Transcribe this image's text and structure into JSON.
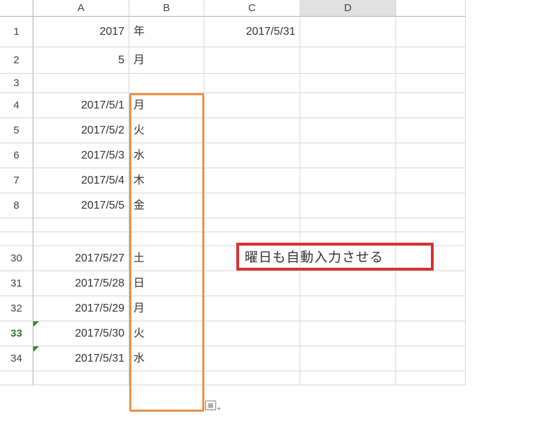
{
  "columns": [
    "",
    "A",
    "B",
    "C",
    "D",
    ""
  ],
  "active_column": "D",
  "active_row": 33,
  "rows_top": [
    {
      "num": 1,
      "a": "2017",
      "b": "年",
      "c": "2017/5/31",
      "h": "row1"
    },
    {
      "num": 2,
      "a": "5",
      "b": "月",
      "c": "",
      "h": "row2"
    },
    {
      "num": 3,
      "a": "",
      "b": "",
      "c": "",
      "h": "row3"
    },
    {
      "num": 4,
      "a": "2017/5/1",
      "b": "月",
      "c": ""
    },
    {
      "num": 5,
      "a": "2017/5/2",
      "b": "火",
      "c": ""
    },
    {
      "num": 6,
      "a": "2017/5/3",
      "b": "水",
      "c": ""
    },
    {
      "num": 7,
      "a": "2017/5/4",
      "b": "木",
      "c": ""
    },
    {
      "num": 8,
      "a": "2017/5/5",
      "b": "金",
      "c": ""
    }
  ],
  "rows_bottom": [
    {
      "num": 30,
      "a": "2017/5/27",
      "b": "土",
      "c": ""
    },
    {
      "num": 31,
      "a": "2017/5/28",
      "b": "日",
      "c": ""
    },
    {
      "num": 32,
      "a": "2017/5/29",
      "b": "月",
      "c": ""
    },
    {
      "num": 33,
      "a": "2017/5/30",
      "b": "火",
      "c": "",
      "err": true
    },
    {
      "num": 34,
      "a": "2017/5/31",
      "b": "水",
      "c": "",
      "err": true
    }
  ],
  "annotation": "曜日も自動入力させる",
  "partial_top_num": "",
  "partial_bottom_num": ""
}
